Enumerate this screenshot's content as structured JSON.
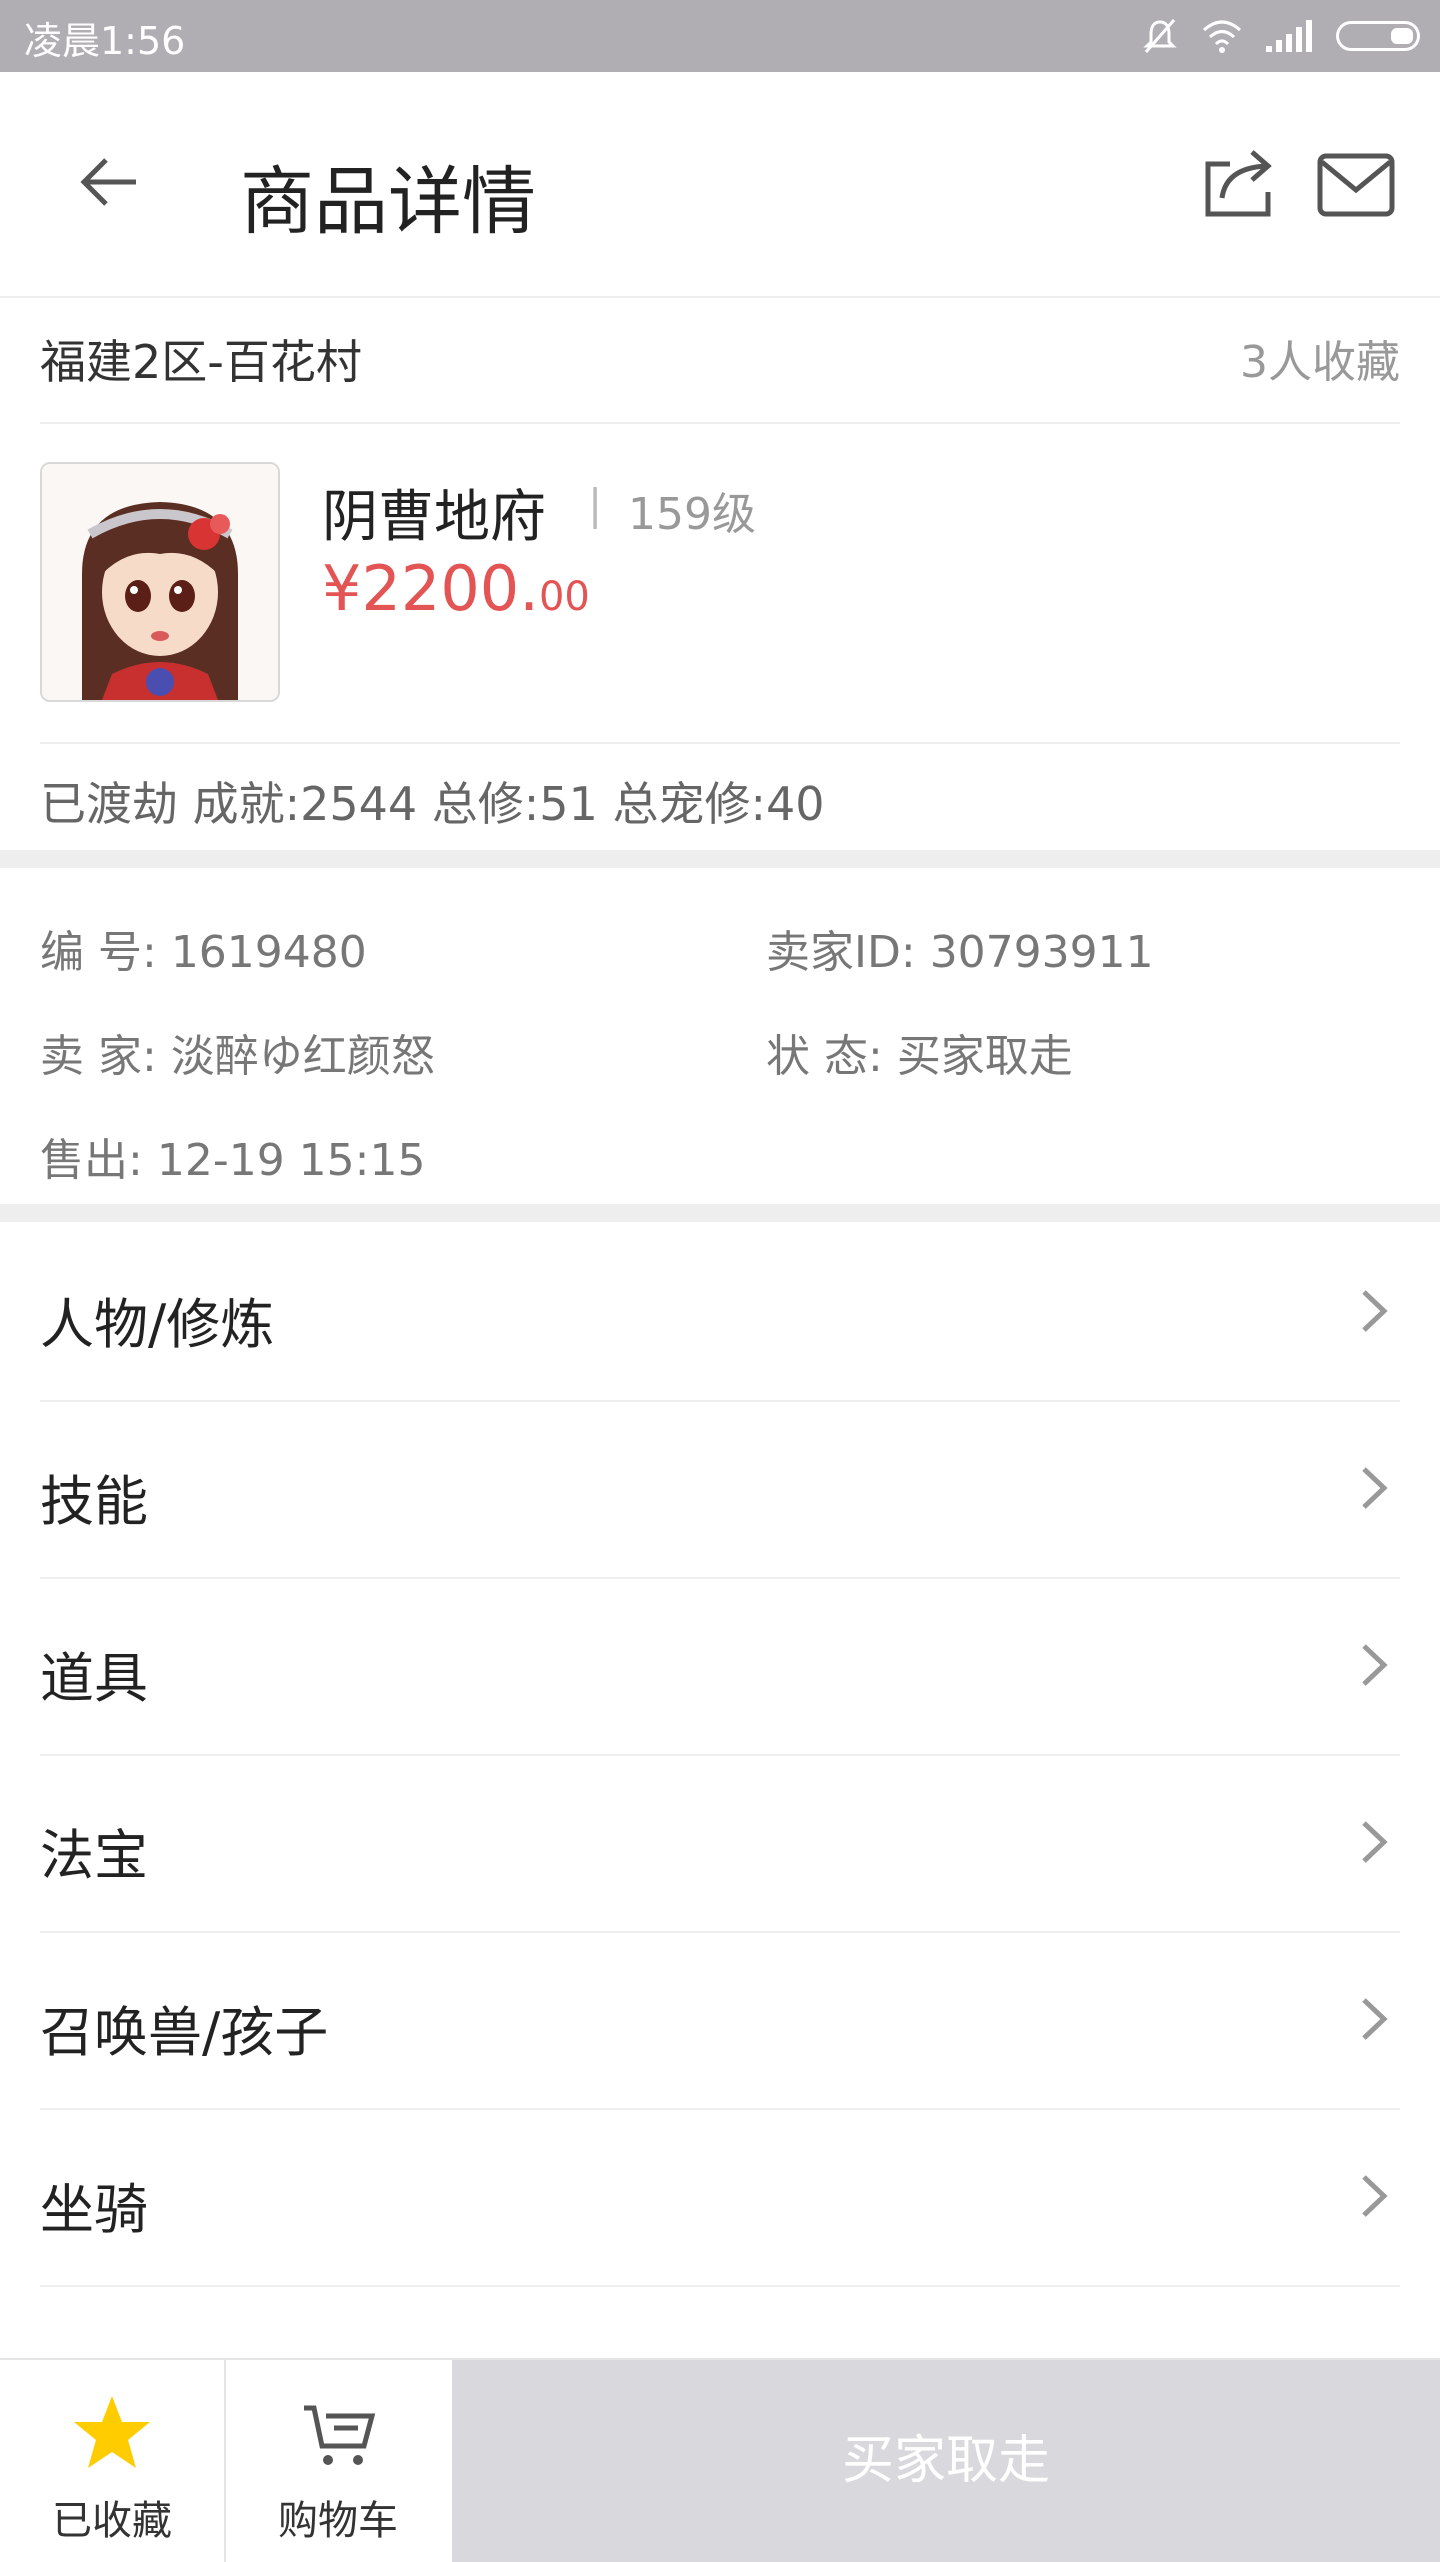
{
  "status_bar": {
    "time": "凌晨1:56"
  },
  "header": {
    "title": "商品详情"
  },
  "server": {
    "name": "福建2区-百花村",
    "favorites": "3人收藏"
  },
  "product": {
    "name": "阴曹地府",
    "separator": "|",
    "level": "159级",
    "price_main": "¥2200.",
    "price_decimal": "00"
  },
  "summary": "已渡劫 成就:2544 总修:51 总宠修:40",
  "info": {
    "serial_label": "编 号:",
    "serial_value": "1619480",
    "seller_id_label": "卖家ID:",
    "seller_id_value": "30793911",
    "seller_label": "卖 家:",
    "seller_value": "淡醉ゆ红颜怒",
    "status_label": "状 态:",
    "status_value": "买家取走",
    "sold_label": "售出:",
    "sold_value": "12-19 15:15"
  },
  "menu": [
    {
      "label": "人物/修炼"
    },
    {
      "label": "技能"
    },
    {
      "label": "道具"
    },
    {
      "label": "法宝"
    },
    {
      "label": "召唤兽/孩子"
    },
    {
      "label": "坐骑"
    }
  ],
  "bottom": {
    "favorite_label": "已收藏",
    "cart_label": "购物车",
    "buy_label": "买家取走"
  },
  "colors": {
    "price": "#e35454",
    "star": "#ffcc00",
    "buy_bg": "#d9d8dc"
  },
  "icons": [
    "back-arrow-icon",
    "share-icon",
    "mail-icon",
    "chevron-right-icon",
    "star-icon",
    "cart-icon",
    "mute-icon",
    "wifi-icon",
    "signal-icon",
    "battery-icon"
  ]
}
